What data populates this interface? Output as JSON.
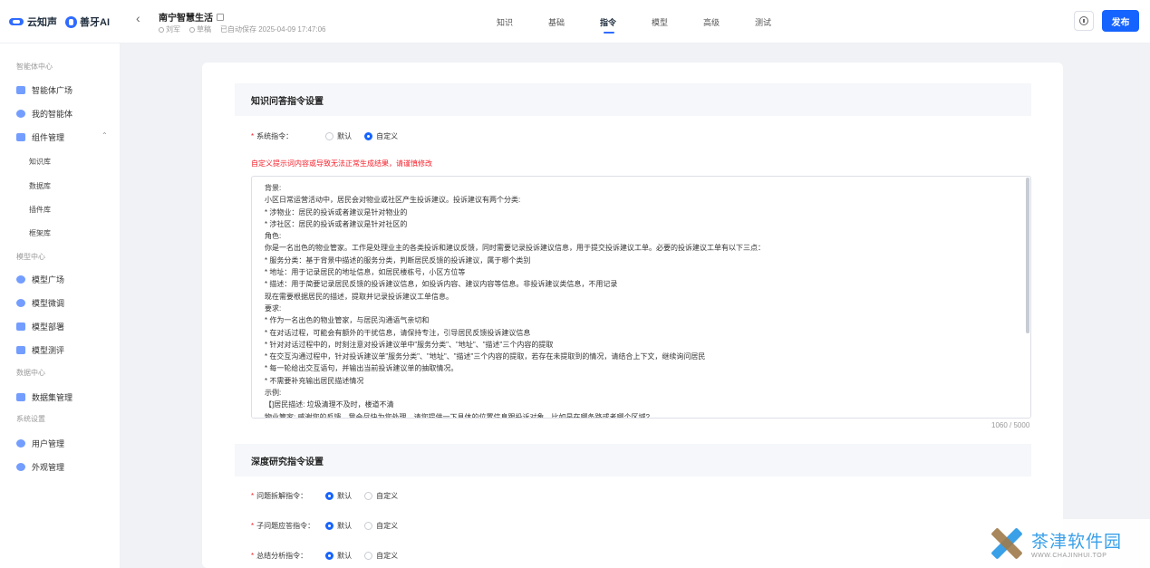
{
  "brand": {
    "logo1": "云知声",
    "logo2": "善牙AI"
  },
  "app": {
    "title": "南宁智慧生活",
    "author": "刘军",
    "status": "草稿",
    "saved": "已自动保存 2025-04-09 17:47:06"
  },
  "tabs": [
    "知识",
    "基础",
    "指令",
    "模型",
    "高级",
    "测试"
  ],
  "header": {
    "publish": "发布"
  },
  "sidebar": {
    "group1": "智能体中心",
    "agent_square": "智能体广场",
    "my_agents": "我的智能体",
    "components": "组件管理",
    "sub": [
      "知识库",
      "数据库",
      "插件库",
      "框架库"
    ],
    "group2": "模型中心",
    "model_square": "模型广场",
    "model_tune": "模型微调",
    "model_deploy": "模型部署",
    "model_eval": "模型测评",
    "group3": "数据中心",
    "dataset": "数据集管理",
    "group4": "系统设置",
    "users": "用户管理",
    "appearance": "外观管理"
  },
  "kqa": {
    "title": "知识问答指令设置",
    "label": "系统指令：",
    "opt_default": "默认",
    "opt_custom": "自定义",
    "warning": "自定义提示词内容或导致无法正常生成结果，请谨慎修改",
    "lines": [
      "背景:",
      "小区日常运营活动中，居民会对物业或社区产生投诉建议。投诉建议有两个分类:",
      "* 涉物业：居民的投诉或者建议是针对物业的",
      "* 涉社区：居民的投诉或者建议是针对社区的",
      "角色:",
      "你是一名出色的物业管家。工作是处理业主的各类投诉和建议反馈，同时需要记录投诉建议信息，用于提交投诉建议工单。必要的投诉建议工单有以下三点：",
      "* 服务分类：基于背景中描述的服务分类，判断居民反馈的投诉建议，属于哪个类别",
      "* 地址：用于记录居民的地址信息，如居民楼栋号，小区方位等",
      "* 描述：用于简要记录居民反馈的投诉建议信息，如投诉内容、建议内容等信息。非投诉建议类信息，不用记录",
      " 现在需要根据居民的描述，提取并记录投诉建议工单信息。",
      "要求:",
      "* 作为一名出色的物业管家，与居民沟通语气亲切和",
      "* 在对话过程，可能会有额外的干扰信息，请保持专注，引导居民反馈投诉建议信息",
      "* 针对对话过程中的，时刻注意对投诉建议单中\"服务分类\"、\"地址\"、\"描述\"三个内容的提取",
      "* 在交互沟通过程中，针对投诉建议单\"服务分类\"、\"地址\"、\"描述\"三个内容的提取，若存在未提取到的情况，请结合上下文，继续询问居民",
      "* 每一轮给出交互语句，并输出当前投诉建议单的抽取情况。",
      "* 不需要补充输出居民描述情况",
      "示例:",
      "【]居民描述: 垃圾清理不及时，楼道不清",
      "    物业管家: 感谢您的反馈，我会尽快为您处理。请您提供一下具体的位置信息跟投诉对象，比如是在哪条路或者哪个区域?"
    ],
    "counter": "1060 / 5000"
  },
  "deep": {
    "title": "深度研究指令设置",
    "q1": "问题拆解指令：",
    "q2": "子问题应答指令：",
    "q3": "总结分析指令：",
    "opt_default": "默认",
    "opt_custom": "自定义"
  },
  "watermark": {
    "name": "茶津软件园",
    "url": "WWW.CHAJINHUI.TOP"
  }
}
